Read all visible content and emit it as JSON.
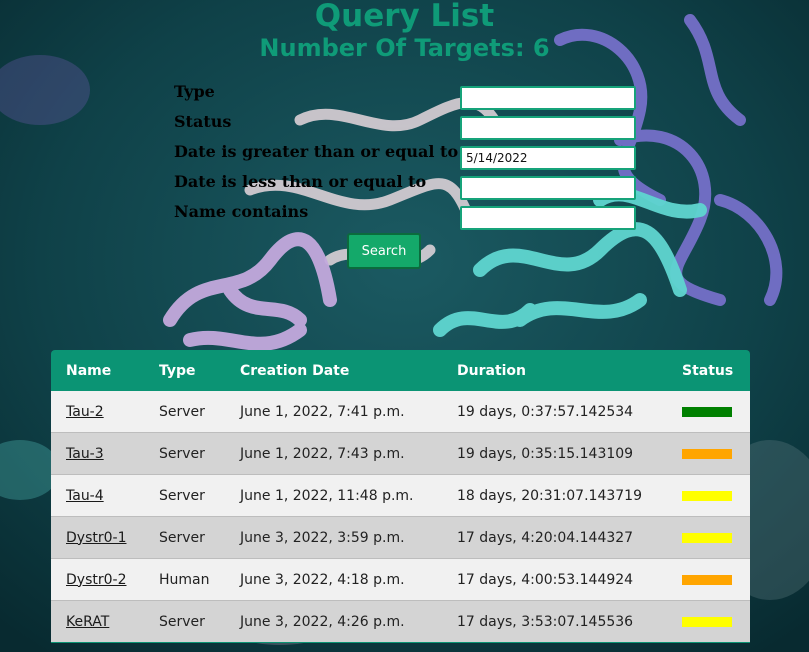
{
  "page": {
    "title": "Query List",
    "subtitle": "Number Of Targets: 6"
  },
  "filters": {
    "type_label": "Type",
    "status_label": "Status",
    "date_gte_label": "Date is greater than or equal to",
    "date_lte_label": "Date is less than or equal to",
    "name_label": "Name contains",
    "type_value": "",
    "status_value": "",
    "date_gte_value": "5/14/2022",
    "date_lte_value": "",
    "name_value": "",
    "search_label": "Search"
  },
  "table": {
    "headers": [
      "Name",
      "Type",
      "Creation Date",
      "Duration",
      "Status"
    ],
    "rows": [
      {
        "name": "Tau-2",
        "type": "Server",
        "created": "June 1, 2022, 7:41 p.m.",
        "duration": "19 days, 0:37:57.142534",
        "status_color": "#008000"
      },
      {
        "name": "Tau-3",
        "type": "Server",
        "created": "June 1, 2022, 7:43 p.m.",
        "duration": "19 days, 0:35:15.143109",
        "status_color": "#ffa500"
      },
      {
        "name": "Tau-4",
        "type": "Server",
        "created": "June 1, 2022, 11:48 p.m.",
        "duration": "18 days, 20:31:07.143719",
        "status_color": "#ffff00"
      },
      {
        "name": "Dystr0-1",
        "type": "Server",
        "created": "June 3, 2022, 3:59 p.m.",
        "duration": "17 days, 4:20:04.144327",
        "status_color": "#ffff00"
      },
      {
        "name": "Dystr0-2",
        "type": "Human",
        "created": "June 3, 2022, 4:18 p.m.",
        "duration": "17 days, 4:00:53.144924",
        "status_color": "#ffa500"
      },
      {
        "name": "KeRAT",
        "type": "Server",
        "created": "June 3, 2022, 4:26 p.m.",
        "duration": "17 days, 3:53:07.145536",
        "status_color": "#ffff00"
      }
    ]
  }
}
